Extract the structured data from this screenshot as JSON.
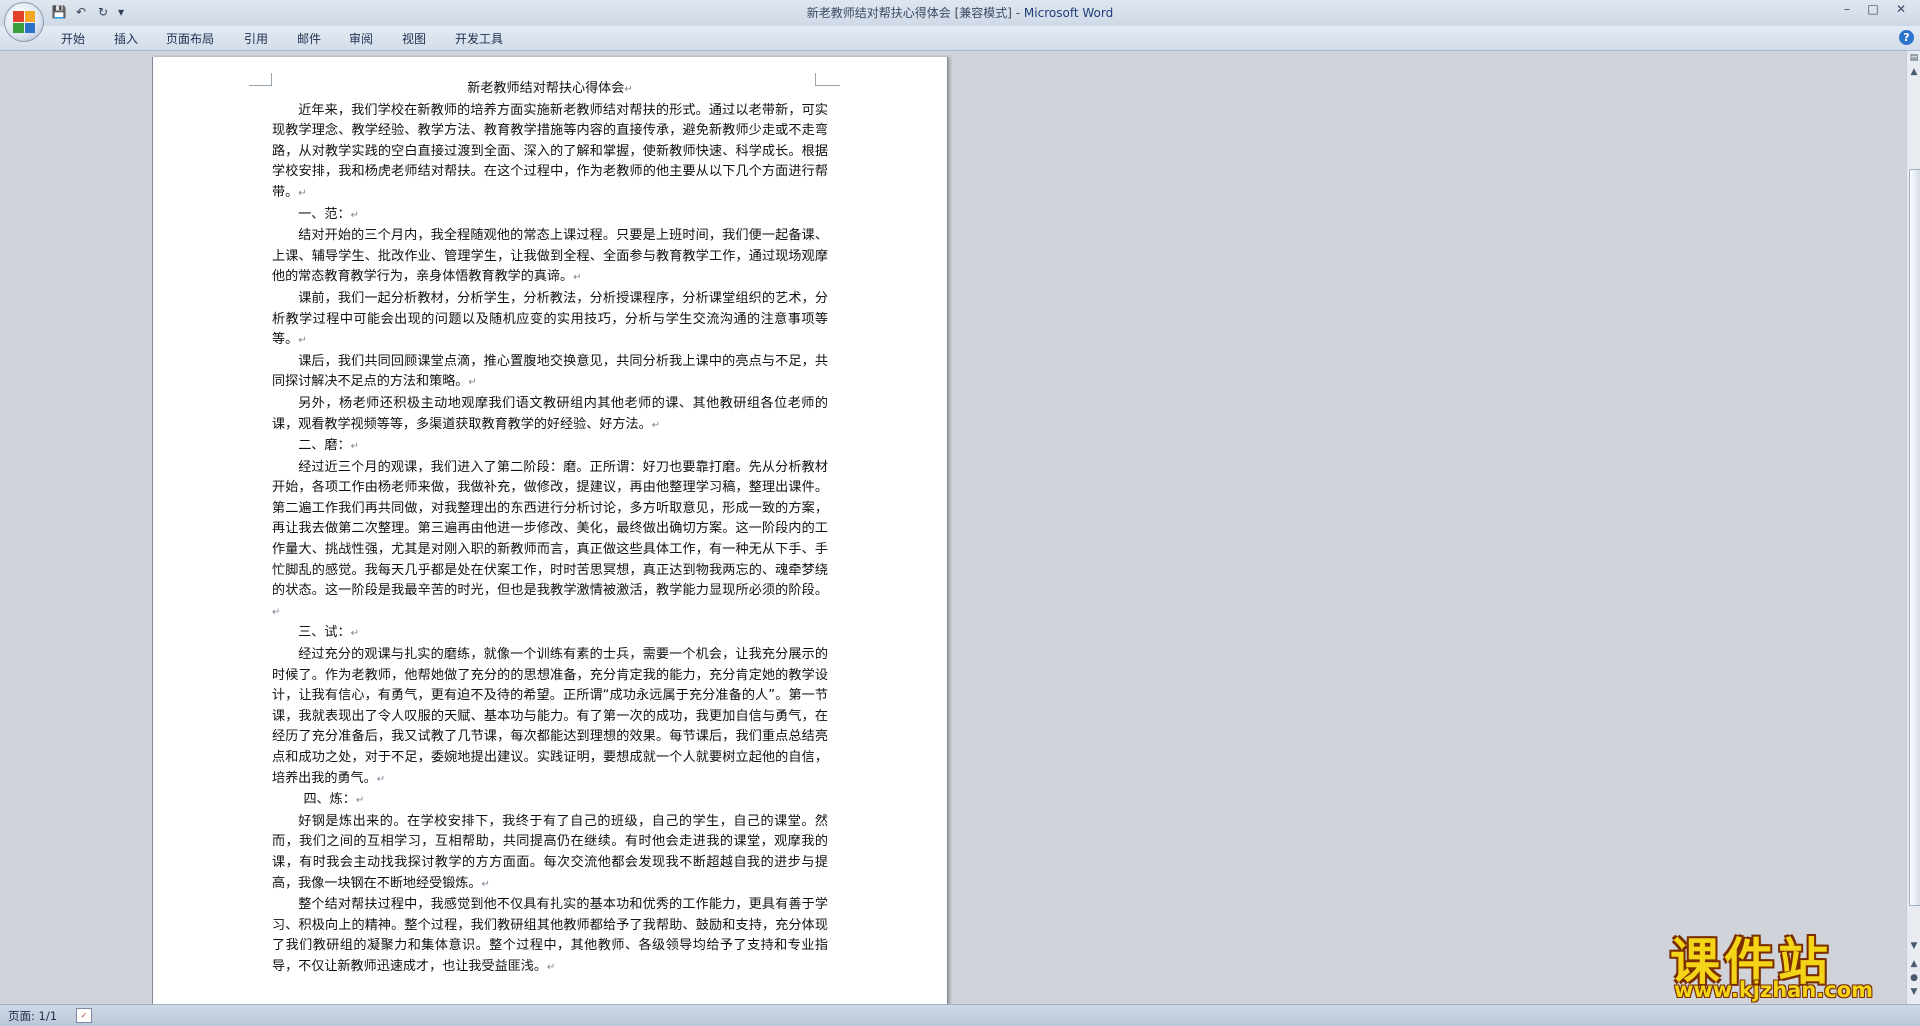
{
  "titlebar": {
    "doc_title": "新老教师结对帮扶心得体会 [兼容模式] - ",
    "app_name": "Microsoft Word",
    "minimize": "–",
    "maximize": "□",
    "close": "✕"
  },
  "qat": {
    "save": "💾",
    "undo": "↶",
    "redo": "↻",
    "customize": "▾"
  },
  "ribbon": {
    "tabs": [
      "开始",
      "插入",
      "页面布局",
      "引用",
      "邮件",
      "审阅",
      "视图",
      "开发工具"
    ],
    "help": "?"
  },
  "document": {
    "paragraph_mark": "↵",
    "paragraphs": [
      "新老教师结对帮扶心得体会",
      "近年来，我们学校在新教师的培养方面实施新老教师结对帮扶的形式。通过以老带新，可实现教学理念、教学经验、教学方法、教育教学措施等内容的直接传承，避免新教师少走或不走弯路，从对教学实践的空白直接过渡到全面、深入的了解和掌握，使新教师快速、科学成长。根据学校安排，我和杨虎老师结对帮扶。在这个过程中，作为老教师的他主要从以下几个方面进行帮带。",
      "一、范：",
      "结对开始的三个月内，我全程随观他的常态上课过程。只要是上班时间，我们便一起备课、上课、辅导学生、批改作业、管理学生，让我做到全程、全面参与教育教学工作，通过现场观摩他的常态教育教学行为，亲身体悟教育教学的真谛。",
      "课前，我们一起分析教材，分析学生，分析教法，分析授课程序，分析课堂组织的艺术，分析教学过程中可能会出现的问题以及随机应变的实用技巧，分析与学生交流沟通的注意事项等等。",
      "课后，我们共同回顾课堂点滴，推心置腹地交换意见，共同分析我上课中的亮点与不足，共同探讨解决不足点的方法和策略。",
      "另外，杨老师还积极主动地观摩我们语文教研组内其他老师的课、其他教研组各位老师的课，观看教学视频等等，多渠道获取教育教学的好经验、好方法。",
      "二、磨：",
      "经过近三个月的观课，我们进入了第二阶段：磨。正所谓：好刀也要靠打磨。先从分析教材开始，各项工作由杨老师来做，我做补充，做修改，提建议，再由他整理学习稿，整理出课件。第二遍工作我们再共同做，对我整理出的东西进行分析讨论，多方听取意见，形成一致的方案，再让我去做第二次整理。第三遍再由他进一步修改、美化，最终做出确切方案。这一阶段内的工作量大、挑战性强，尤其是对刚入职的新教师而言，真正做这些具体工作，有一种无从下手、手忙脚乱的感觉。我每天几乎都是处在伏案工作，时时苦思冥想，真正达到物我两忘的、魂牵梦绕的状态。这一阶段是我最辛苦的时光，但也是我教学激情被激活，教学能力显现所必须的阶段。",
      "三、试：",
      "经过充分的观课与扎实的磨练，就像一个训练有素的士兵，需要一个机会，让我充分展示的时候了。作为老教师，他帮她做了充分的的思想准备，充分肯定我的能力，充分肯定她的教学设计，让我有信心，有勇气，更有迫不及待的希望。正所谓“成功永远属于充分准备的人”。第一节课，我就表现出了令人叹服的天赋、基本功与能力。有了第一次的成功，我更加自信与勇气，在经历了充分准备后，我又试教了几节课，每次都能达到理想的效果。每节课后，我们重点总结亮点和成功之处，对于不足，委婉地提出建议。实践证明，要想成就一个人就要树立起他的自信，培养出我的勇气。",
      "四、炼：",
      "好钢是炼出来的。在学校安排下，我终于有了自己的班级，自己的学生，自己的课堂。然而，我们之间的互相学习，互相帮助，共同提高仍在继续。有时他会走进我的课堂，观摩我的课，有时我会主动找我探讨教学的方方面面。每次交流他都会发现我不断超越自我的进步与提高，我像一块钢在不断地经受锻炼。",
      "整个结对帮扶过程中，我感觉到他不仅具有扎实的基本功和优秀的工作能力，更具有善于学习、积极向上的精神。整个过程，我们教研组其他教师都给予了我帮助、鼓励和支持，充分体现了我们教研组的凝聚力和集体意识。整个过程中，其他教师、各级领导均给予了支持和专业指导，不仅让新教师迅速成才，也让我受益匪浅。"
    ]
  },
  "statusbar": {
    "page": "页面: 1/1",
    "lang_icon": "✓"
  },
  "watermark": {
    "main": "课件站",
    "url": "www.kjzhan.com"
  },
  "scrollbar": {
    "up": "▲",
    "down": "▼",
    "prev": "▲",
    "select": "●",
    "next": "▼"
  }
}
